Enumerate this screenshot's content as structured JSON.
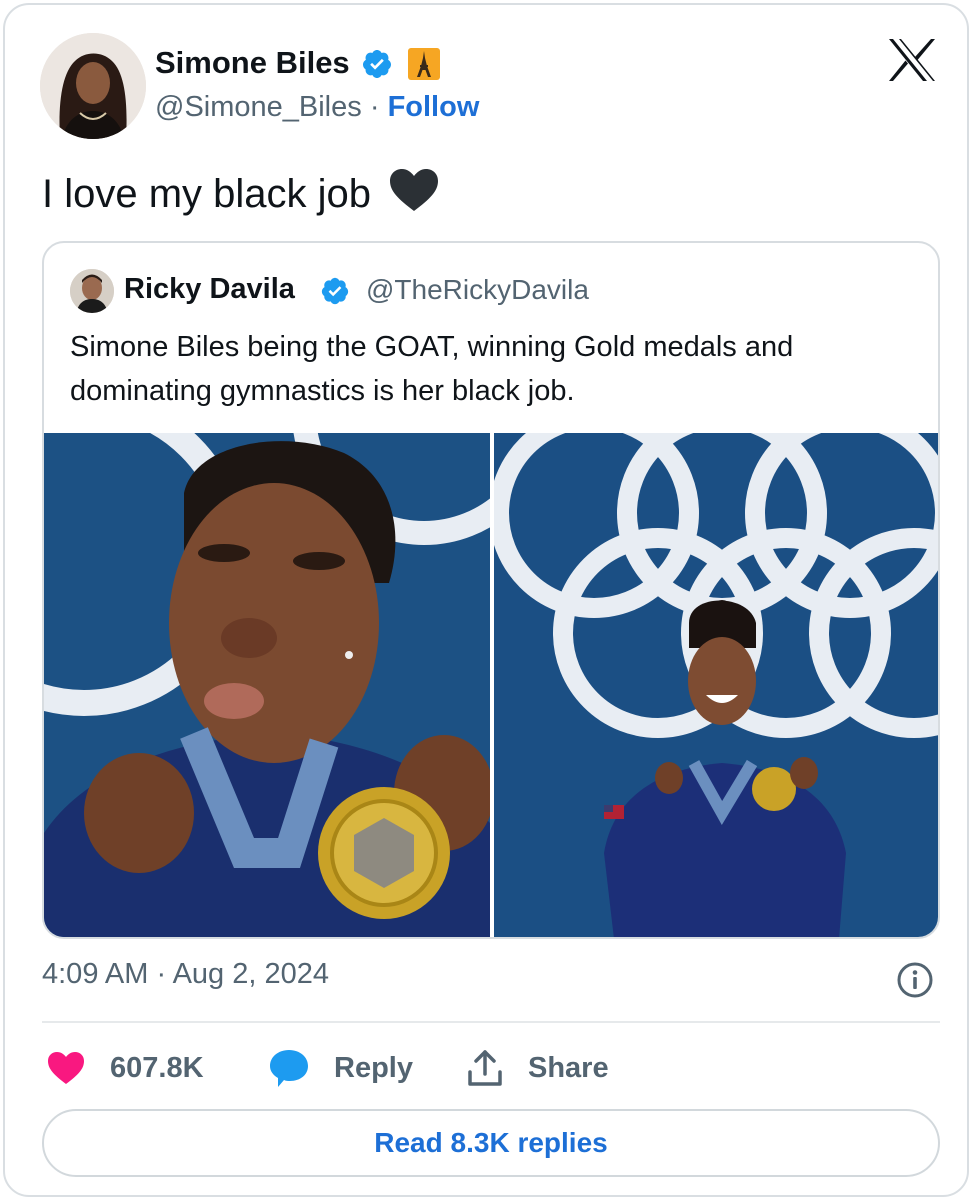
{
  "author": {
    "name": "Simone Biles",
    "handle": "@Simone_Biles",
    "separator": "·",
    "follow_label": "Follow",
    "verified_icon": "verified-badge-icon",
    "flair_icon": "eiffel-tower-emoji"
  },
  "tweet": {
    "text": "I love my black job",
    "emoji": "black-heart-emoji"
  },
  "quote": {
    "name": "Ricky Davila",
    "handle": "@TheRickyDavila",
    "text": "Simone Biles being the GOAT, winning Gold medals and dominating gymnastics is her black job.",
    "images": [
      "athlete-kissing-gold-medal-photo",
      "athlete-smiling-with-medal-olympic-rings-photo"
    ]
  },
  "meta": {
    "timestamp": "4:09 AM · Aug 2, 2024"
  },
  "actions": {
    "likes": "607.8K",
    "reply_label": "Reply",
    "share_label": "Share"
  },
  "read_replies_label": "Read 8.3K replies",
  "colors": {
    "link_blue": "#1d6fd6",
    "like_pink": "#f91880",
    "reply_blue": "#1d9bf0",
    "olympic_blue": "#1c5184"
  }
}
